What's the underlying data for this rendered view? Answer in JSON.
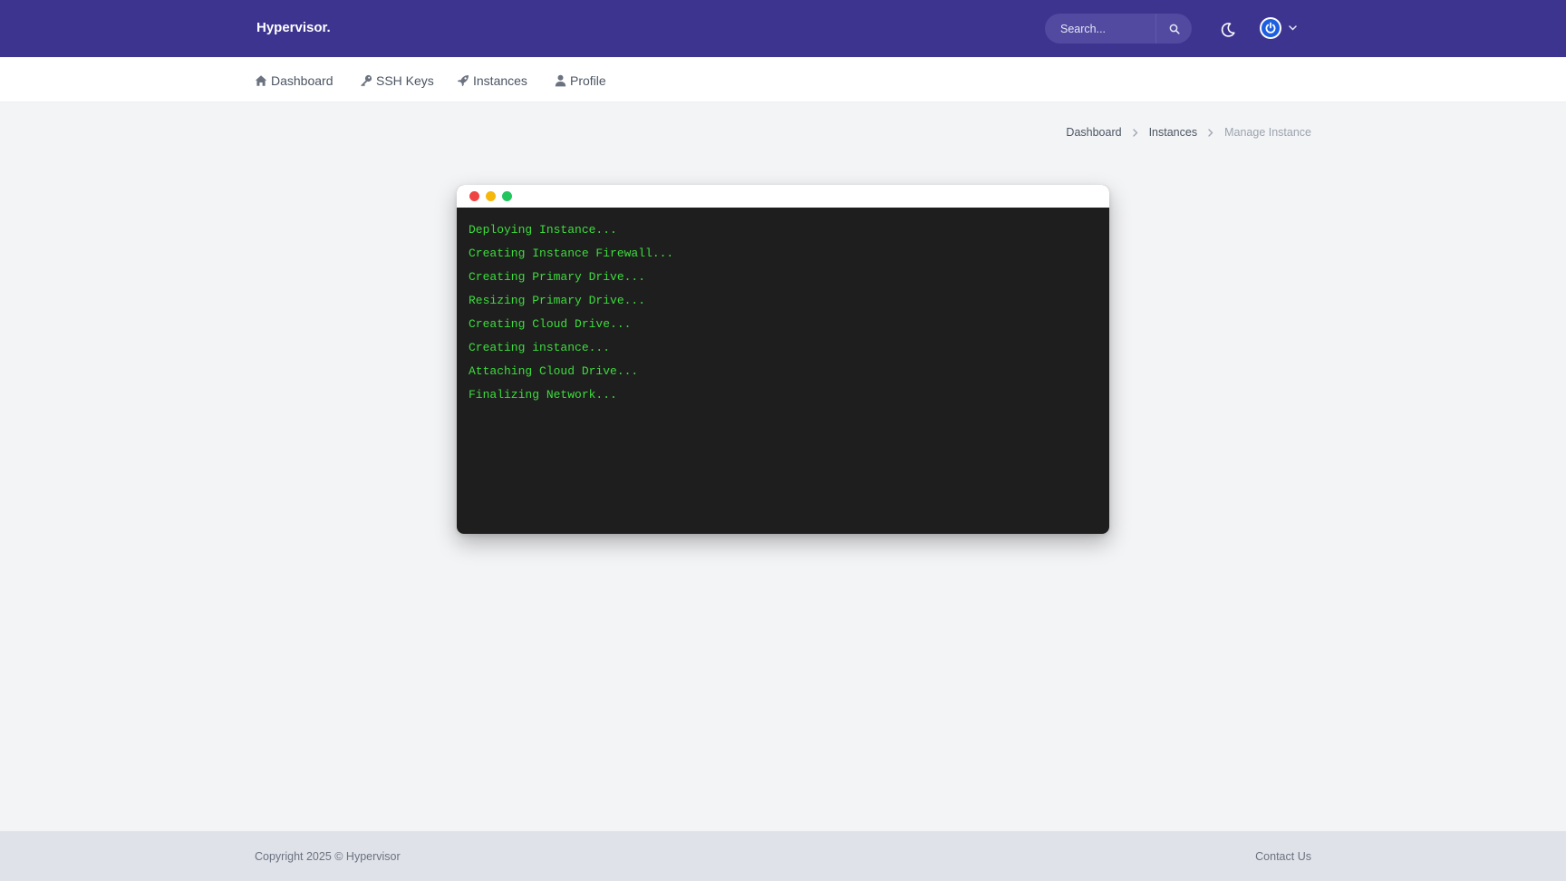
{
  "header": {
    "brand": "Hypervisor.",
    "search": {
      "placeholder": "Search..."
    },
    "icons": {
      "search": "search-icon",
      "theme": "moon-icon",
      "avatar": "power-icon",
      "menu": "chevron-down-icon"
    }
  },
  "nav": {
    "items": [
      {
        "label": "Dashboard",
        "icon": "home-icon"
      },
      {
        "label": "SSH Keys",
        "icon": "key-icon"
      },
      {
        "label": "Instances",
        "icon": "rocket-icon"
      },
      {
        "label": "Profile",
        "icon": "user-icon"
      }
    ]
  },
  "breadcrumb": {
    "items": [
      "Dashboard",
      "Instances",
      "Manage Instance"
    ]
  },
  "terminal": {
    "dot_colors": [
      "#ef4444",
      "#f5b70b",
      "#22c55e"
    ],
    "text_color": "#3ddc3d",
    "lines": [
      "Deploying Instance...",
      "Creating Instance Firewall...",
      "Creating Primary Drive...",
      "Resizing Primary Drive...",
      "Creating Cloud Drive...",
      "Creating instance...",
      "Attaching Cloud Drive...",
      "Finalizing Network..."
    ]
  },
  "footer": {
    "copyright": "Copyright 2025 © Hypervisor",
    "contact": "Contact Us"
  },
  "colors": {
    "topbar": "#3d3490",
    "page_bg": "#f3f4f6",
    "footer_bg": "#dfe2e8",
    "terminal_bg": "#1e1e1e"
  }
}
